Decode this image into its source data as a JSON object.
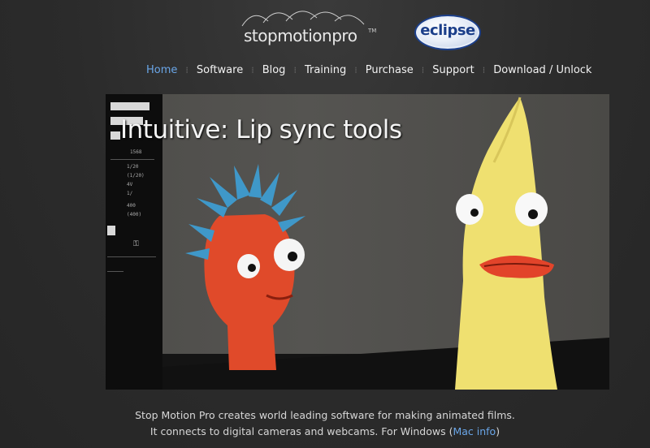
{
  "header": {
    "logo_text": "stopmotionpro",
    "logo_tm": "TM",
    "partner_logo_text": "eclipse"
  },
  "nav": {
    "items": [
      {
        "label": "Home",
        "active": true
      },
      {
        "label": "Software",
        "active": false
      },
      {
        "label": "Blog",
        "active": false
      },
      {
        "label": "Training",
        "active": false
      },
      {
        "label": "Purchase",
        "active": false
      },
      {
        "label": "Support",
        "active": false
      },
      {
        "label": "Download / Unlock",
        "active": false
      }
    ]
  },
  "hero": {
    "title": "Intuitive: Lip sync tools",
    "ui_values": [
      "1568",
      "1/20",
      "(1/20)",
      "4V",
      "1/",
      "400",
      "(400)"
    ]
  },
  "intro": {
    "line1": "Stop Motion Pro creates world leading software for making animated films.",
    "line2_prefix": "It connects to digital cameras and webcams.  For Windows (",
    "mac_link": "Mac info",
    "line2_suffix": ")"
  },
  "colors": {
    "background": "#2b2b2b",
    "nav_active": "#6aa6e8",
    "link": "#6aa6e8",
    "text": "#d6d6d6"
  }
}
